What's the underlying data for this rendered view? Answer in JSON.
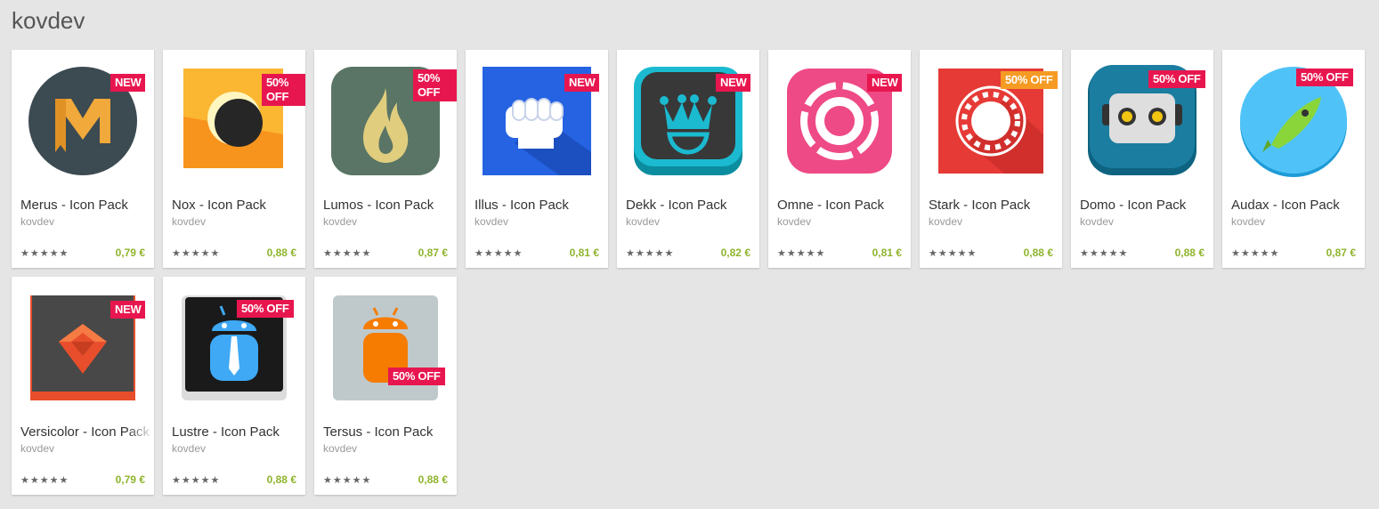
{
  "developer_title": "kovdev",
  "colors": {
    "price": "#8fb42d",
    "badge_new": "#e8164f",
    "badge_sale": "#f59b24"
  },
  "apps": [
    {
      "name": "Merus - Icon Pack",
      "developer": "kovdev",
      "price": "0,79 €",
      "badge": "NEW",
      "rating": 4.5,
      "icon": "merus-icon"
    },
    {
      "name": "Nox - Icon Pack",
      "developer": "kovdev",
      "price": "0,88 €",
      "badge": "50% OFF",
      "rating": 4.5,
      "icon": "nox-icon"
    },
    {
      "name": "Lumos - Icon Pack",
      "developer": "kovdev",
      "price": "0,87 €",
      "badge": "50% OFF",
      "rating": 4.5,
      "icon": "lumos-icon"
    },
    {
      "name": "Illus - Icon Pack",
      "developer": "kovdev",
      "price": "0,81 €",
      "badge": "NEW",
      "rating": 5,
      "icon": "illus-icon"
    },
    {
      "name": "Dekk - Icon Pack",
      "developer": "kovdev",
      "price": "0,82 €",
      "badge": "NEW",
      "rating": 5,
      "icon": "dekk-icon"
    },
    {
      "name": "Omne - Icon Pack",
      "developer": "kovdev",
      "price": "0,81 €",
      "badge": "NEW",
      "rating": 4.5,
      "icon": "omne-icon"
    },
    {
      "name": "Stark - Icon Pack",
      "developer": "kovdev",
      "price": "0,88 €",
      "badge": "50% OFF",
      "rating": 4.5,
      "icon": "stark-icon"
    },
    {
      "name": "Domo - Icon Pack",
      "developer": "kovdev",
      "price": "0,88 €",
      "badge": "50% OFF",
      "rating": 4.5,
      "icon": "domo-icon"
    },
    {
      "name": "Audax - Icon Pack",
      "developer": "kovdev",
      "price": "0,87 €",
      "badge": "50% OFF",
      "rating": 4.5,
      "icon": "audax-icon"
    },
    {
      "name": "Versicolor - Icon Pack",
      "developer": "kovdev",
      "price": "0,79 €",
      "badge": "NEW",
      "rating": 4.5,
      "icon": "versicolor-icon"
    },
    {
      "name": "Lustre - Icon Pack",
      "developer": "kovdev",
      "price": "0,88 €",
      "badge": "50% OFF",
      "rating": 4.5,
      "icon": "lustre-icon"
    },
    {
      "name": "Tersus - Icon Pack",
      "developer": "kovdev",
      "price": "0,88 €",
      "badge": "50% OFF",
      "rating": 4.5,
      "icon": "tersus-icon"
    }
  ]
}
